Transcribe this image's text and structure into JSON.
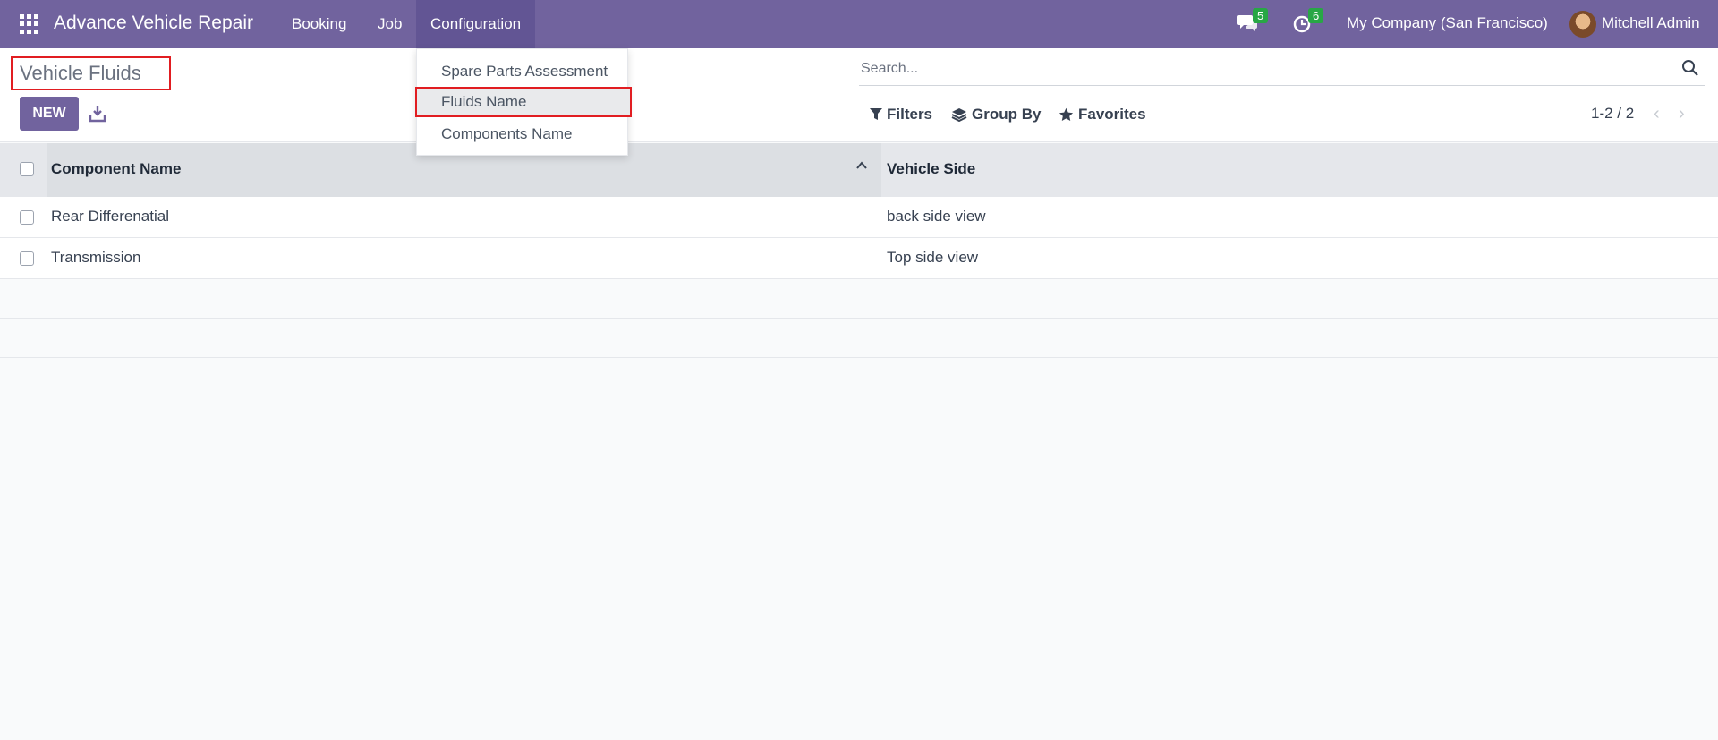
{
  "navbar": {
    "brand": "Advance Vehicle Repair",
    "menu": [
      "Booking",
      "Job",
      "Configuration"
    ],
    "messages_count": "5",
    "activities_count": "6",
    "company": "My Company (San Francisco)",
    "user": "Mitchell Admin",
    "bg_color": "#71639e"
  },
  "configuration_menu": {
    "items": [
      "Spare Parts Assessment",
      "Fluids Name",
      "Components Name"
    ],
    "selected": "Fluids Name"
  },
  "control_panel": {
    "title": "Vehicle Fluids",
    "new_label": "NEW",
    "search_placeholder": "Search...",
    "filters_label": "Filters",
    "groupby_label": "Group By",
    "favorites_label": "Favorites",
    "pager": "1-2 / 2"
  },
  "table": {
    "columns": [
      "Component Name",
      "Vehicle Side"
    ],
    "rows": [
      {
        "component": "Rear Differenatial",
        "side": "back side view"
      },
      {
        "component": "Transmission",
        "side": "Top side view"
      }
    ]
  }
}
